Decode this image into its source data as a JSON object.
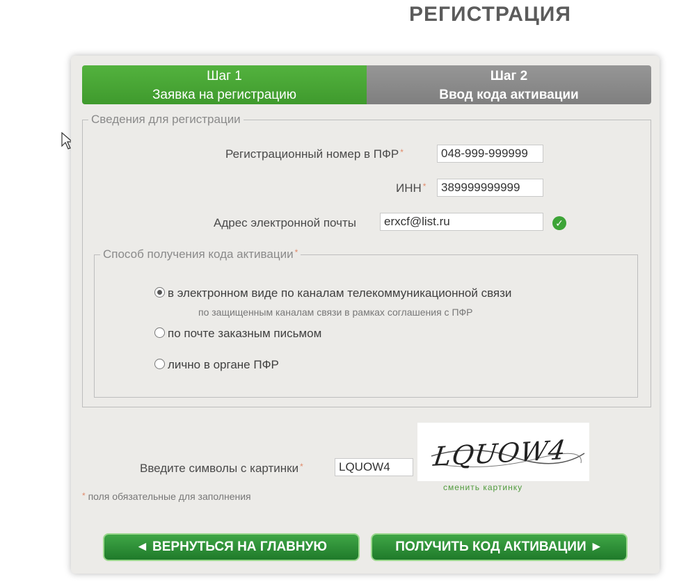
{
  "page": {
    "title": "РЕГИСТРАЦИЯ"
  },
  "steps": [
    {
      "number": "Шаг 1",
      "label": "Заявка на регистрацию",
      "state": "active"
    },
    {
      "number": "Шаг 2",
      "label": "Ввод кода активации",
      "state": "inactive"
    }
  ],
  "info_section": {
    "legend": "Сведения для регистрации",
    "fields": {
      "pfr": {
        "label": "Регистрационный номер в ПФР",
        "required": "*",
        "value": "048-999-999999"
      },
      "inn": {
        "label": "ИНН",
        "required": "*",
        "value": "389999999999"
      },
      "email": {
        "label": "Адрес электронной почты",
        "value": "erxcf@list.ru",
        "status_icon": "check-circle-icon"
      }
    }
  },
  "activation_section": {
    "legend": "Способ получения кода активации",
    "required": "*",
    "options": [
      {
        "label": "в электронном виде по каналам телекоммуникационной связи",
        "note": "по защищенным каналам связи в рамках соглашения с ПФР",
        "checked": true
      },
      {
        "label": "по почте заказным письмом",
        "checked": false
      },
      {
        "label": "лично в органе ПФР",
        "checked": false
      }
    ]
  },
  "captcha": {
    "label": "Введите символы с картинки",
    "required": "*",
    "value": "LQUOW4",
    "image_text": "LQUOW4",
    "refresh_link": "сменить картинку"
  },
  "hint": {
    "marker": "*",
    "text": "поля обязательные для заполнения"
  },
  "buttons": {
    "back": "◄ ВЕРНУТЬСЯ НА ГЛАВНУЮ",
    "submit": "ПОЛУЧИТЬ КОД АКТИВАЦИИ ►"
  },
  "colors": {
    "accent": "#3fa646",
    "inactive_step": "#8a8a8a",
    "panel_bg": "#ecebe8"
  }
}
